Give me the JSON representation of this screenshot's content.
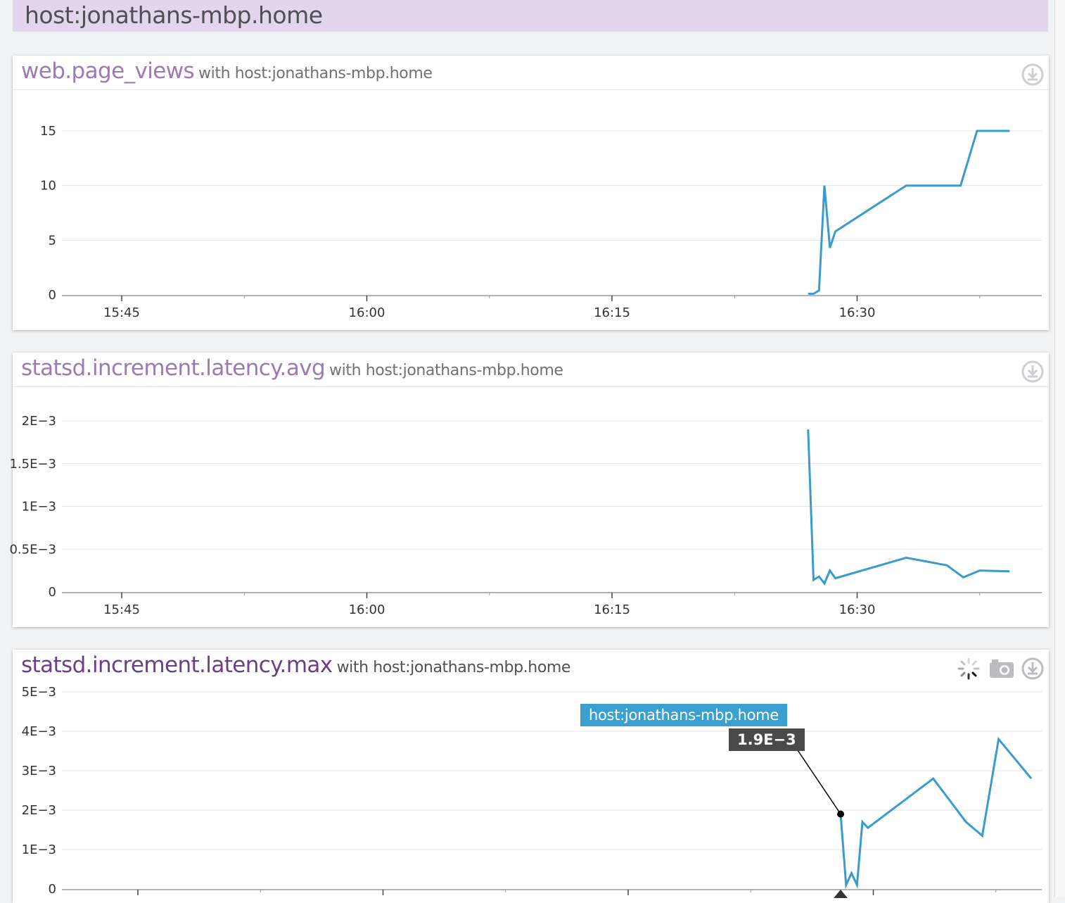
{
  "header": {
    "title": "host:jonathans-mbp.home"
  },
  "colors": {
    "series": "#3a9bcd",
    "header_bg": "#e2d5ec",
    "metric_title": "#9b7bb2",
    "metric_title_active": "#6a3f88",
    "tooltip_bg": "#3aa0d0",
    "tooltip_value_bg": "#4a4a4a"
  },
  "panels": [
    {
      "metric": "web.page_views",
      "scope": "with host:jonathans-mbp.home",
      "icons": [
        "download-icon"
      ]
    },
    {
      "metric": "statsd.increment.latency.avg",
      "scope": "with host:jonathans-mbp.home",
      "icons": [
        "download-icon"
      ]
    },
    {
      "metric": "statsd.increment.latency.max",
      "scope": "with host:jonathans-mbp.home",
      "icons": [
        "loading-spinner-icon",
        "camera-icon",
        "download-icon"
      ]
    }
  ],
  "tooltip": {
    "host": "host:jonathans-mbp.home",
    "value": "1.9E−3"
  },
  "chart_data": [
    {
      "type": "line",
      "title": "web.page_views",
      "x_ticks": [
        "15:45",
        "16:00",
        "16:15",
        "16:30"
      ],
      "y_ticks": [
        "0",
        "5",
        "10",
        "15"
      ],
      "ylim": [
        0,
        15
      ],
      "grid": true,
      "series": [
        {
          "x": [
            "16:27:00",
            "16:27:20",
            "16:27:40",
            "16:28:00",
            "16:28:20",
            "16:28:40",
            "16:33:00",
            "16:36:20",
            "16:37:20",
            "16:39:20"
          ],
          "y": [
            0.1,
            0.1,
            0.4,
            10,
            4.3,
            5.8,
            10,
            10,
            15,
            15
          ]
        }
      ]
    },
    {
      "type": "line",
      "title": "statsd.increment.latency.avg",
      "x_ticks": [
        "15:45",
        "16:00",
        "16:15",
        "16:30"
      ],
      "y_ticks": [
        "0",
        "0.5E−3",
        "1E−3",
        "1.5E−3",
        "2E−3"
      ],
      "ylim": [
        0,
        0.002
      ],
      "grid": true,
      "series": [
        {
          "x": [
            "16:27:00",
            "16:27:20",
            "16:27:40",
            "16:28:00",
            "16:28:20",
            "16:28:40",
            "16:33:00",
            "16:35:30",
            "16:36:30",
            "16:37:30",
            "16:39:20"
          ],
          "y": [
            0.0019,
            0.00014,
            0.00018,
            0.0001,
            0.00025,
            0.00016,
            0.0004,
            0.00031,
            0.00017,
            0.00025,
            0.00024
          ]
        }
      ]
    },
    {
      "type": "line",
      "title": "statsd.increment.latency.max",
      "x_ticks": [
        "15:45",
        "16:00",
        "16:15",
        "16:30"
      ],
      "y_ticks": [
        "0",
        "1E−3",
        "2E−3",
        "3E−3",
        "4E−3",
        "5E−3"
      ],
      "ylim": [
        0,
        0.005
      ],
      "grid": true,
      "series": [
        {
          "x": [
            "16:28:00",
            "16:28:20",
            "16:28:40",
            "16:29:00",
            "16:29:20",
            "16:29:40",
            "16:33:40",
            "16:35:40",
            "16:36:40",
            "16:37:40",
            "16:39:40"
          ],
          "y": [
            0.0019,
            0.0001,
            0.0004,
            0.0001,
            0.0017,
            0.00155,
            0.0028,
            0.0017,
            0.00135,
            0.0038,
            0.0028
          ]
        }
      ],
      "hover": {
        "x": "16:28:00",
        "y": 0.0019
      }
    }
  ]
}
